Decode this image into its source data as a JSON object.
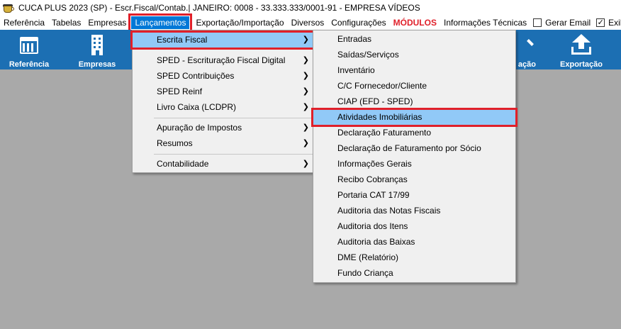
{
  "window": {
    "title": "CUCA PLUS 2023 (SP) - Escr.Fiscal/Contab.| JANEIRO: 0008 - 33.333.333/0001-91 - EMPRESA VÍDEOS",
    "icon": "coffee-cup-icon"
  },
  "menubar": {
    "items": [
      "Referência",
      "Tabelas",
      "Empresas",
      "Lançamentos",
      "Exportação/Importação",
      "Diversos",
      "Configurações",
      "MÓDULOS",
      "Informações Técnicas"
    ],
    "gerar_email_label": "Gerar Email",
    "gerar_email_checked": false,
    "exibir_label": "Exib",
    "exibir_checked": true,
    "active_index": 3,
    "modulos_color": "#e0202a"
  },
  "toolbar": {
    "background": "#1c6fb3",
    "buttons": [
      {
        "label": "Referência",
        "icon": "calendar-icon"
      },
      {
        "label": "Empresas",
        "icon": "building-icon"
      },
      {
        "label": "ação",
        "icon": "partial-icon"
      },
      {
        "label": "Exportação",
        "icon": "upload-icon"
      }
    ]
  },
  "lancamentos_menu": {
    "items": [
      {
        "label": "Escrita Fiscal",
        "submenu": true
      },
      {
        "label": "SPED - Escrituração Fiscal Digital",
        "submenu": true
      },
      {
        "label": "SPED Contribuições",
        "submenu": true
      },
      {
        "label": "SPED Reinf",
        "submenu": true
      },
      {
        "label": "Livro Caixa (LCDPR)",
        "submenu": true
      },
      {
        "label": "Apuração de Impostos",
        "submenu": true
      },
      {
        "label": "Resumos",
        "submenu": true
      },
      {
        "label": "Contabilidade",
        "submenu": true
      }
    ],
    "highlighted": "Escrita Fiscal"
  },
  "escrita_fiscal_menu": {
    "items": [
      "Entradas",
      "Saídas/Serviços",
      "Inventário",
      "C/C Fornecedor/Cliente",
      "CIAP (EFD - SPED)",
      "Atividades Imobiliárias",
      "Declaração Faturamento",
      "Declaração de Faturamento por Sócio",
      "Informações Gerais",
      "Recibo Cobranças",
      "Portaria CAT 17/99",
      "Auditoria das Notas Fiscais",
      "Auditoria dos Itens",
      "Auditoria das Baixas",
      "DME (Relatório)",
      "Fundo Criança"
    ],
    "highlighted": "Atividades Imobiliárias",
    "highlight_color": "#91c9f7",
    "marker_color": "#e0202a"
  }
}
